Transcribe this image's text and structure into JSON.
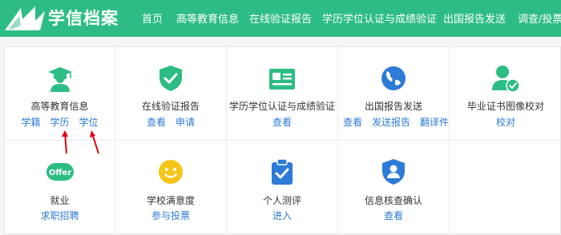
{
  "app": {
    "title": "学信档案"
  },
  "nav": [
    "首页",
    "高等教育信息",
    "在线验证报告",
    "学历学位认证与成绩验证",
    "出国报告发送",
    "调查/投票"
  ],
  "colors": {
    "brand": "#2dbd84",
    "link": "#2d7bd6",
    "arrow": "#e60012"
  },
  "cells": [
    {
      "title": "高等教育信息",
      "icon": "graduate-icon",
      "links": [
        "学籍",
        "学历",
        "学位"
      ]
    },
    {
      "title": "在线验证报告",
      "icon": "shield-check-icon",
      "links": [
        "查看",
        "申请"
      ]
    },
    {
      "title": "学历学位认证与成绩验证",
      "icon": "certificate-icon",
      "links": [
        "查看"
      ]
    },
    {
      "title": "出国报告发送",
      "icon": "globe-icon",
      "links": [
        "查看",
        "发送报告",
        "翻译件"
      ]
    },
    {
      "title": "毕业证书图像校对",
      "icon": "user-check-icon",
      "links": [
        "校对"
      ]
    },
    {
      "title": "就业",
      "icon": "offer-icon",
      "icon_text": "Offer",
      "links": [
        "求职招聘"
      ]
    },
    {
      "title": "学校满意度",
      "icon": "smiley-icon",
      "links": [
        "参与投票"
      ]
    },
    {
      "title": "个人测评",
      "icon": "clipboard-check-icon",
      "links": [
        "进入"
      ]
    },
    {
      "title": "信息核查确认",
      "icon": "user-shield-icon",
      "links": [
        "查看"
      ]
    }
  ]
}
